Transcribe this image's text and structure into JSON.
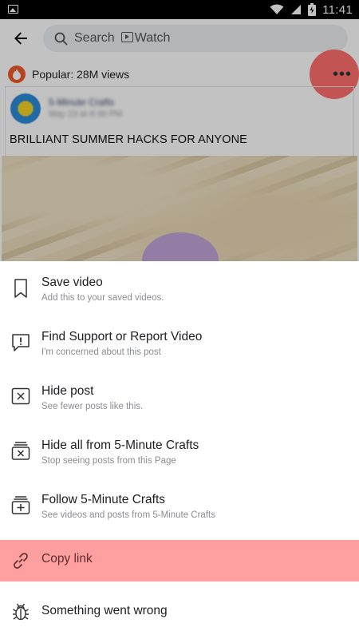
{
  "status_bar": {
    "time": "11:41"
  },
  "search": {
    "label": "Search",
    "watch_label": "Watch"
  },
  "post": {
    "popular_text": "Popular: 28M views",
    "author": "5-Minute Crafts",
    "date": "May 23 at 8:30 PM",
    "title": "BRILLIANT SUMMER HACKS FOR ANYONE"
  },
  "menu": {
    "items": [
      {
        "label": "Save video",
        "sub": "Add this to your saved videos.",
        "icon": "bookmark-icon"
      },
      {
        "label": "Find Support or Report Video",
        "sub": "I'm concerned about this post",
        "icon": "report-icon"
      },
      {
        "label": "Hide post",
        "sub": "See fewer posts like this.",
        "icon": "hide-icon"
      },
      {
        "label": "Hide all from 5-Minute Crafts",
        "sub": "Stop seeing posts from this Page",
        "icon": "hide-all-icon"
      },
      {
        "label": "Follow 5-Minute Crafts",
        "sub": "See videos and posts from 5-Minute Crafts",
        "icon": "follow-icon"
      },
      {
        "label": "Copy link",
        "sub": "",
        "icon": "link-icon"
      },
      {
        "label": "Something went wrong",
        "sub": "",
        "icon": "bug-icon"
      }
    ]
  },
  "colors": {
    "highlight": "#ff9f9f",
    "more_highlight": "#ff6f6f",
    "text": "#1c1e21",
    "subtext": "#8a8d91"
  }
}
